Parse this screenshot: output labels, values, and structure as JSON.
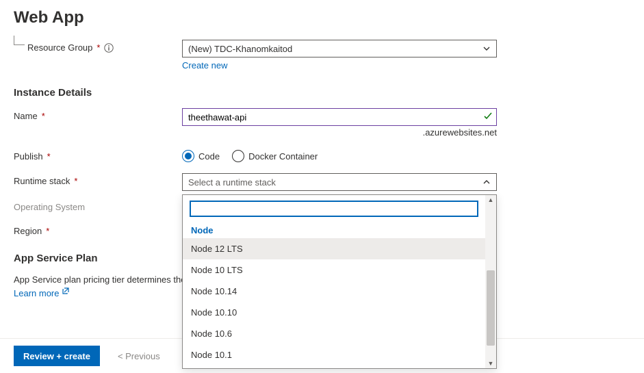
{
  "page_title": "Web App",
  "resource_group": {
    "label": "Resource Group",
    "selected": "(New) TDC-Khanomkaitod",
    "create_new": "Create new"
  },
  "instance_details_header": "Instance Details",
  "name": {
    "label": "Name",
    "value": "theethawat-api",
    "suffix": ".azurewebsites.net"
  },
  "publish": {
    "label": "Publish",
    "options": [
      "Code",
      "Docker Container"
    ],
    "selected_index": 0
  },
  "runtime_stack": {
    "label": "Runtime stack",
    "placeholder": "Select a runtime stack",
    "dropdown": {
      "group_label": "Node",
      "options": [
        "Node 12 LTS",
        "Node 10 LTS",
        "Node 10.14",
        "Node 10.10",
        "Node 10.6",
        "Node 10.1"
      ],
      "highlighted_index": 0
    }
  },
  "operating_system": {
    "label": "Operating System"
  },
  "region": {
    "label": "Region"
  },
  "app_service_plan": {
    "header": "App Service Plan",
    "help_text": "App Service plan pricing tier determines the",
    "learn_more": "Learn more"
  },
  "footer": {
    "review_create": "Review + create",
    "previous": "< Previous"
  }
}
